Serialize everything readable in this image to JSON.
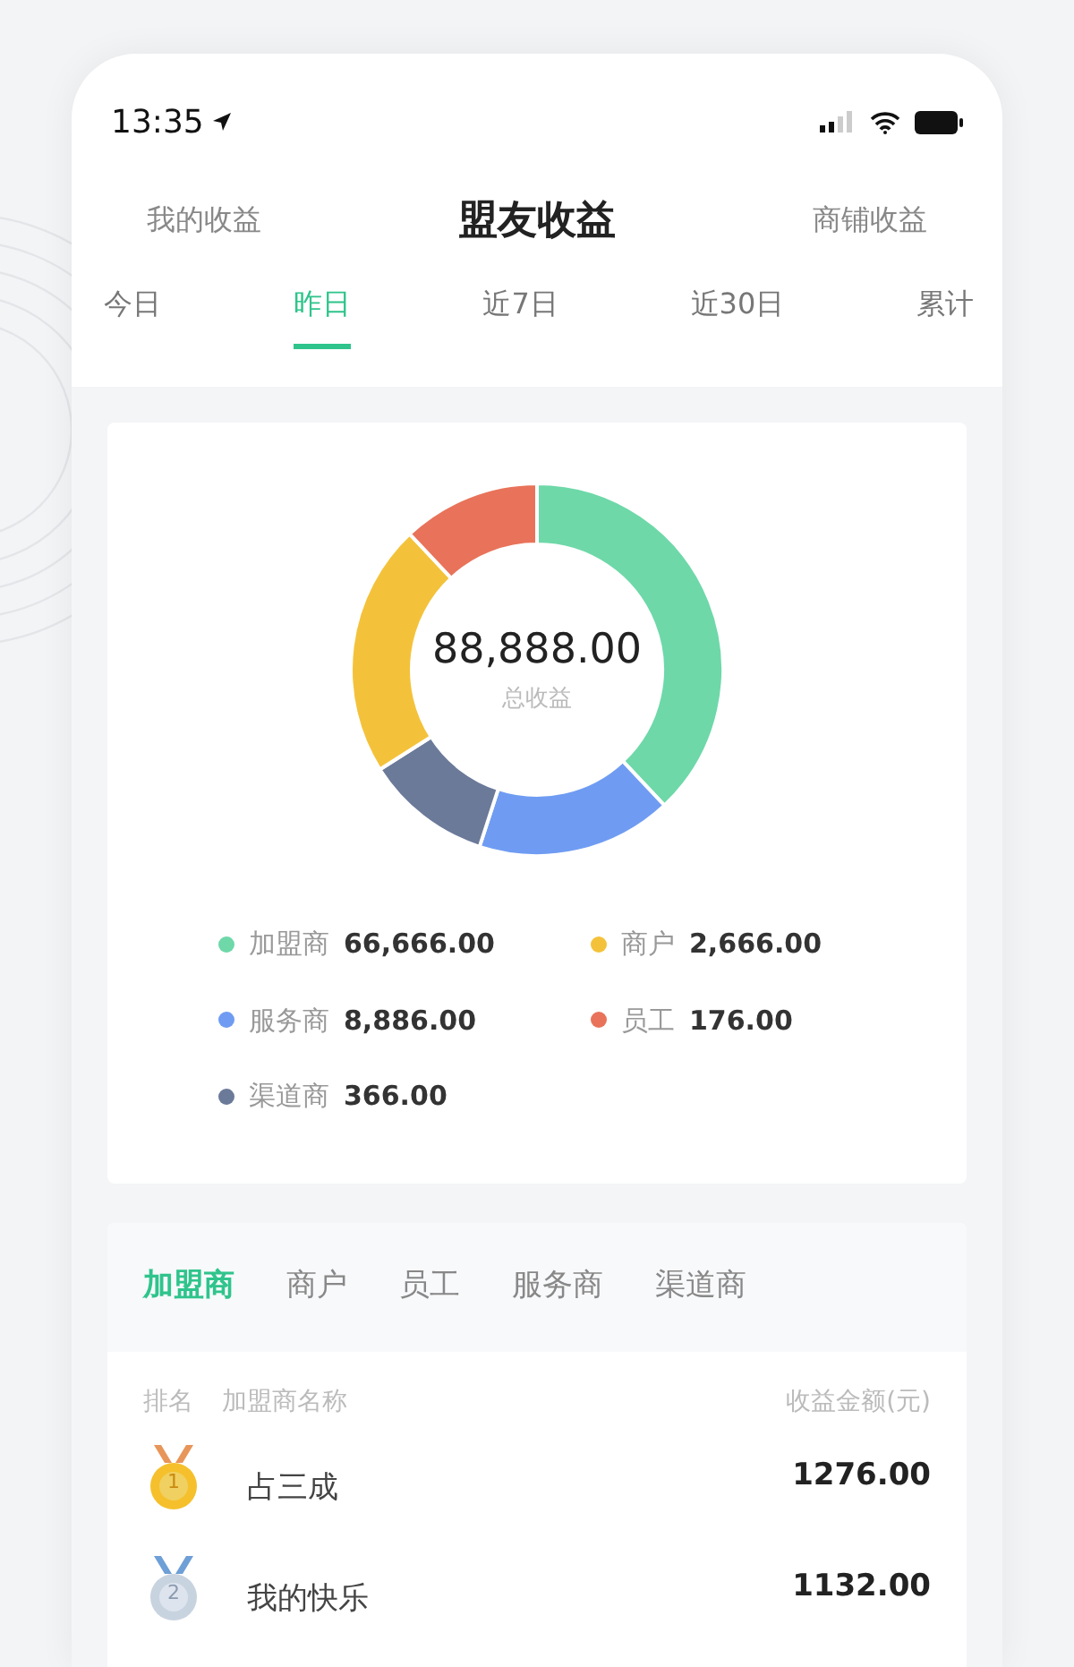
{
  "status_bar": {
    "time": "13:35"
  },
  "header": {
    "tabs": [
      {
        "label": "我的收益",
        "selected": false
      },
      {
        "label": "盟友收益",
        "selected": true
      },
      {
        "label": "商铺收益",
        "selected": false
      }
    ]
  },
  "period_tabs": [
    {
      "label": "今日",
      "selected": false
    },
    {
      "label": "昨日",
      "selected": true
    },
    {
      "label": "近7日",
      "selected": false
    },
    {
      "label": "近30日",
      "selected": false
    },
    {
      "label": "累计",
      "selected": false
    }
  ],
  "summary": {
    "total": "88,888.00",
    "total_label": "总收益",
    "legend": [
      {
        "name": "加盟商",
        "value": "66,666.00",
        "color": "#6ed8a8"
      },
      {
        "name": "商户",
        "value": "2,666.00",
        "color": "#f4c23a"
      },
      {
        "name": "服务商",
        "value": "8,886.00",
        "color": "#6f9cf2"
      },
      {
        "name": "员工",
        "value": "176.00",
        "color": "#e8735a"
      },
      {
        "name": "渠道商",
        "value": "366.00",
        "color": "#6b7a99"
      }
    ]
  },
  "ranking": {
    "tabs": [
      {
        "label": "加盟商",
        "selected": true
      },
      {
        "label": "商户",
        "selected": false
      },
      {
        "label": "员工",
        "selected": false
      },
      {
        "label": "服务商",
        "selected": false
      },
      {
        "label": "渠道商",
        "selected": false
      }
    ],
    "columns": [
      "排名",
      "加盟商名称",
      "收益金额(元)"
    ],
    "rows": [
      {
        "rank": "1",
        "name": "占三成",
        "amount": "1276.00",
        "kind": "gold"
      },
      {
        "rank": "2",
        "name": "我的快乐",
        "amount": "1132.00",
        "kind": "silver"
      }
    ]
  }
}
